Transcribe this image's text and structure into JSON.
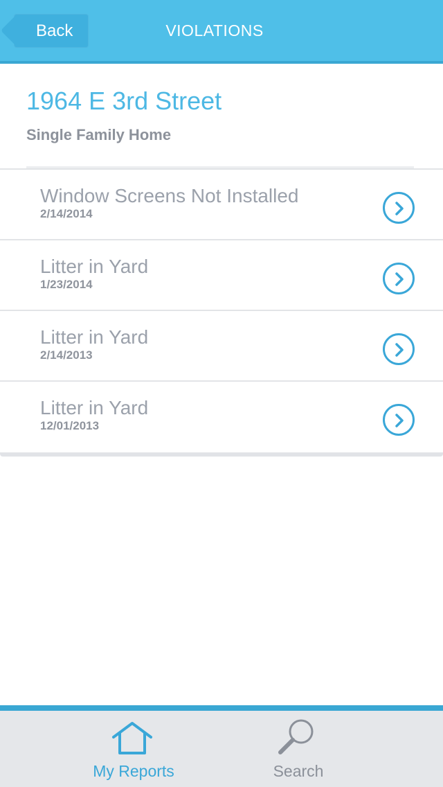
{
  "header": {
    "back_label": "Back",
    "title": "VIOLATIONS"
  },
  "property": {
    "address": "1964 E 3rd Street",
    "type": "Single Family Home"
  },
  "violations": [
    {
      "title": "Window Screens Not Installed",
      "date": "2/14/2014"
    },
    {
      "title": "Litter in Yard",
      "date": "1/23/2014"
    },
    {
      "title": "Litter in Yard",
      "date": "2/14/2013"
    },
    {
      "title": "Litter in Yard",
      "date": "12/01/2013"
    }
  ],
  "tabbar": {
    "reports": {
      "label": "My Reports",
      "icon": "house-icon",
      "active": true
    },
    "search": {
      "label": "Search",
      "icon": "magnifier-icon",
      "active": false
    }
  },
  "colors": {
    "accent": "#4fbfe8",
    "accent_dark": "#3aa7d3",
    "muted_text": "#9ba1ab",
    "tabbar_bg": "#e5e7ea"
  }
}
